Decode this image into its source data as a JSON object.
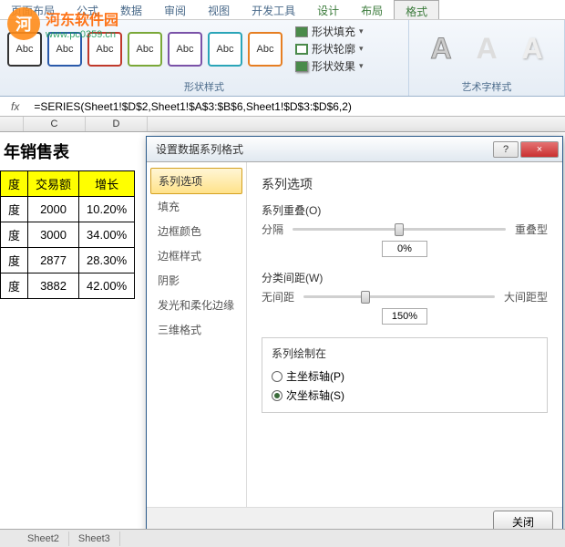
{
  "ribbon": {
    "tabs": [
      "页面布局",
      "公式",
      "数据",
      "审阅",
      "视图",
      "开发工具",
      "设计",
      "布局",
      "格式"
    ],
    "activeTab": "格式",
    "abcLabel": "Abc",
    "effects": {
      "fill": "形状填充",
      "outline": "形状轮廓",
      "fx": "形状效果"
    },
    "groupShapeStyles": "形状样式",
    "groupWordArt": "艺术字样式",
    "wordartLetter": "A"
  },
  "formulaBar": {
    "fxLabel": "fx",
    "value": "=SERIES(Sheet1!$D$2,Sheet1!$A$3:$B$6,Sheet1!$D$3:$D$6,2)"
  },
  "columns": {
    "c": "C",
    "d": "D"
  },
  "table": {
    "title": "年销售表",
    "headers": {
      "col1": "度",
      "col2": "交易额",
      "col3": "增长"
    },
    "rows": [
      {
        "q": "度",
        "amt": "2000",
        "grow": "10.20%"
      },
      {
        "q": "度",
        "amt": "3000",
        "grow": "34.00%"
      },
      {
        "q": "度",
        "amt": "2877",
        "grow": "28.30%"
      },
      {
        "q": "度",
        "amt": "3882",
        "grow": "42.00%"
      }
    ]
  },
  "dialog": {
    "title": "设置数据系列格式",
    "help": "?",
    "close": "×",
    "sidebar": [
      "系列选项",
      "填充",
      "边框颜色",
      "边框样式",
      "阴影",
      "发光和柔化边缘",
      "三维格式"
    ],
    "content": {
      "heading": "系列选项",
      "overlap": {
        "label": "系列重叠(O)",
        "left": "分隔",
        "right": "重叠型",
        "value": "0%"
      },
      "gap": {
        "label": "分类间距(W)",
        "left": "无间距",
        "right": "大间距型",
        "value": "150%"
      },
      "plotOn": {
        "legend": "系列绘制在",
        "primary": "主坐标轴(P)",
        "secondary": "次坐标轴(S)"
      }
    },
    "footer": {
      "close": "关闭"
    }
  },
  "watermark": {
    "logo": "河",
    "title": "河东软件园",
    "url": "www.pc0359.cn"
  },
  "sheetTabs": [
    "Sheet2",
    "Sheet3"
  ],
  "chart_data": {
    "type": "table",
    "title": "年销售表",
    "columns": [
      "季度",
      "交易额",
      "增长"
    ],
    "rows": [
      [
        "一季度",
        2000,
        "10.20%"
      ],
      [
        "二季度",
        3000,
        "34.00%"
      ],
      [
        "三季度",
        2877,
        "28.30%"
      ],
      [
        "四季度",
        3882,
        "42.00%"
      ]
    ]
  }
}
